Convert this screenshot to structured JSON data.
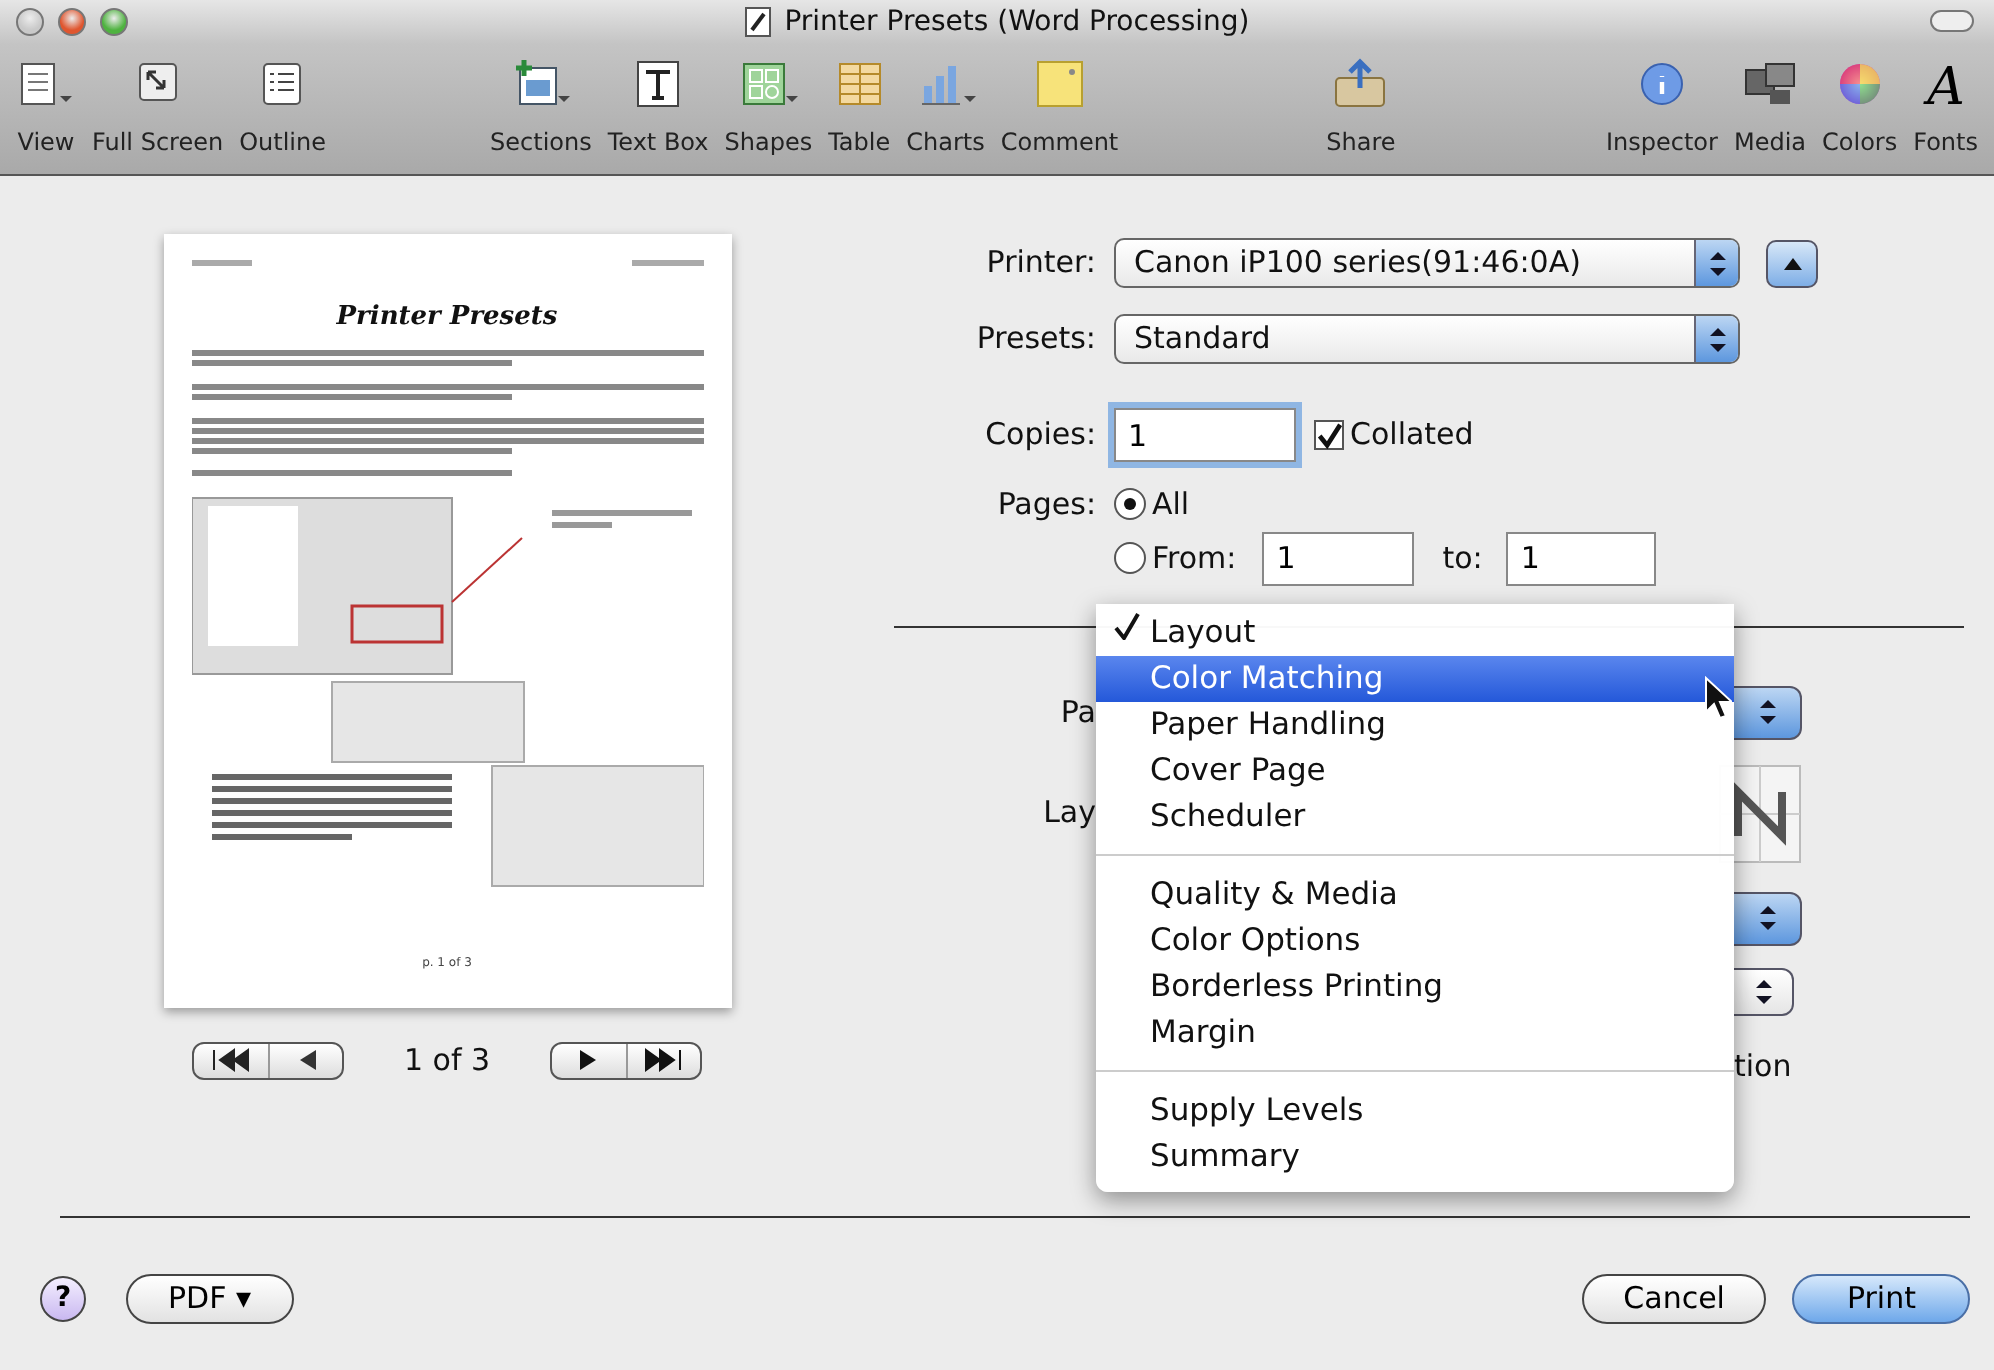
{
  "window": {
    "title": "Printer Presets (Word Processing)"
  },
  "toolbar": [
    [
      {
        "kind": "view",
        "label": "View"
      },
      {
        "kind": "fullscreen",
        "label": "Full Screen"
      },
      {
        "kind": "outline",
        "label": "Outline"
      }
    ],
    [
      {
        "kind": "sections",
        "label": "Sections"
      },
      {
        "kind": "textbox",
        "label": "Text Box"
      },
      {
        "kind": "shapes",
        "label": "Shapes"
      },
      {
        "kind": "table",
        "label": "Table"
      },
      {
        "kind": "charts",
        "label": "Charts"
      },
      {
        "kind": "comment",
        "label": "Comment"
      }
    ],
    [
      {
        "kind": "share",
        "label": "Share"
      }
    ],
    [
      {
        "kind": "inspector",
        "label": "Inspector"
      },
      {
        "kind": "media",
        "label": "Media"
      },
      {
        "kind": "colors",
        "label": "Colors"
      },
      {
        "kind": "fonts",
        "label": "Fonts",
        "glyph": "A"
      }
    ]
  ],
  "preview": {
    "page_title": "Printer Presets",
    "page_footer": "p. 1 of 3",
    "page_label": "1 of 3"
  },
  "form": {
    "printer": {
      "label": "Printer:",
      "value": "Canon iP100 series(91:46:0A)"
    },
    "presets": {
      "label": "Presets:",
      "value": "Standard"
    },
    "copies": {
      "label": "Copies:",
      "value": "1"
    },
    "collated": {
      "label": "Collated",
      "checked": true
    },
    "pages": {
      "label": "Pages:",
      "options": [
        {
          "label": "All",
          "selected": true
        },
        {
          "label": "From:",
          "selected": false
        }
      ],
      "from": "1",
      "to_label": "to:",
      "to": "1"
    }
  },
  "partial_labels": [
    "Pa",
    "Lay",
    "tion"
  ],
  "menu": {
    "groups": [
      [
        {
          "label": "Layout",
          "checked": true,
          "highlighted": false
        },
        {
          "label": "Color Matching",
          "checked": false,
          "highlighted": true
        },
        {
          "label": "Paper Handling",
          "checked": false,
          "highlighted": false
        },
        {
          "label": "Cover Page",
          "checked": false,
          "highlighted": false
        },
        {
          "label": "Scheduler",
          "checked": false,
          "highlighted": false
        }
      ],
      [
        {
          "label": "Quality & Media",
          "checked": false,
          "highlighted": false
        },
        {
          "label": "Color Options",
          "checked": false,
          "highlighted": false
        },
        {
          "label": "Borderless Printing",
          "checked": false,
          "highlighted": false
        },
        {
          "label": "Margin",
          "checked": false,
          "highlighted": false
        }
      ],
      [
        {
          "label": "Supply Levels",
          "checked": false,
          "highlighted": false
        },
        {
          "label": "Summary",
          "checked": false,
          "highlighted": false
        }
      ]
    ]
  },
  "footer": {
    "help": "?",
    "pdf": "PDF ▾",
    "cancel": "Cancel",
    "print": "Print"
  }
}
